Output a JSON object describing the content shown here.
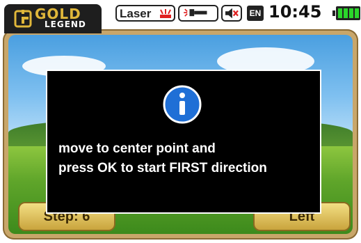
{
  "header": {
    "logo": {
      "brand_top": "GOLD",
      "brand_bottom": "LEGEND"
    },
    "laser_label": "Laser",
    "language": "EN",
    "time": "10:45",
    "icons": [
      "laser-beam-icon",
      "torch-icon",
      "speaker-muted-icon",
      "battery-full-icon"
    ],
    "battery_level": 1.0
  },
  "buttons": {
    "left_label": "Step: 6",
    "right_label": "Left"
  },
  "dialog": {
    "icon": "info-icon",
    "message_line1": "move to center point and",
    "message_line2": "press OK to start FIRST direction"
  },
  "colors": {
    "brand_gold": "#e0b73a",
    "dialog_bg": "#000000",
    "info_blue": "#1f6fd6",
    "battery_green": "#2bd62b",
    "button_gold": "#e8cc68"
  }
}
